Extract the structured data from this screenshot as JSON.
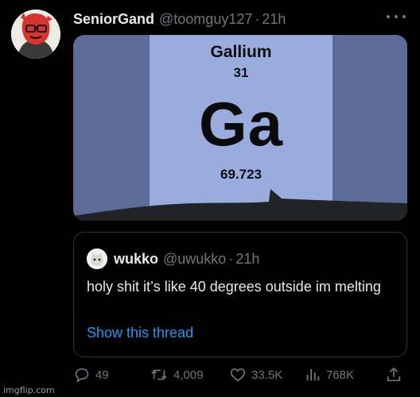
{
  "tweet": {
    "display_name": "SeniorGand",
    "handle": "@toomguy127",
    "separator": "·",
    "time": "21h"
  },
  "media": {
    "element_name": "Gallium",
    "atomic_number": "31",
    "symbol": "Ga",
    "atomic_mass": "69.723"
  },
  "quoted_tweet": {
    "display_name": "wukko",
    "handle": "@uwukko",
    "separator": "·",
    "time": "21h",
    "text": "holy shit it’s like 40 degrees outside im melting",
    "show_thread": "Show this thread"
  },
  "actions": {
    "replies": "49",
    "retweets": "4,009",
    "likes": "33.5K",
    "views": "768K"
  },
  "watermark": "imgflip.com",
  "colors": {
    "background": "#000000",
    "link": "#1d9bf0",
    "muted": "#71767b",
    "tile": "#9aacde",
    "tile_bg": "#5c6b98"
  },
  "icons": [
    "more-icon",
    "reply-icon",
    "retweet-icon",
    "like-icon",
    "views-icon",
    "share-icon"
  ]
}
